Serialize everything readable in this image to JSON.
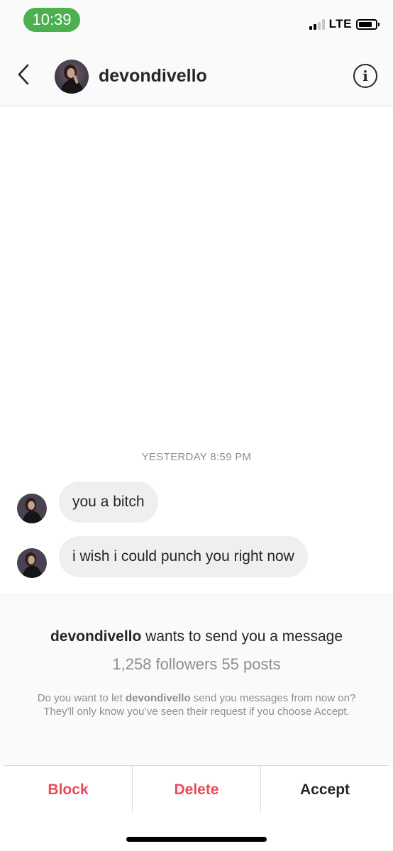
{
  "status_bar": {
    "time": "10:39",
    "network": "LTE",
    "time_pill_color": "#4caf50",
    "signal_bars_on": 2,
    "signal_bars_total": 4
  },
  "header": {
    "username": "devondivello",
    "back_icon": "chevron-left-icon",
    "info_icon": "info-icon",
    "info_glyph": "i"
  },
  "conversation": {
    "timestamp": "YESTERDAY 8:59 PM",
    "messages": [
      {
        "text": "you a bitch"
      },
      {
        "text": "i wish i could punch you right now"
      }
    ]
  },
  "request": {
    "username": "devondivello",
    "title_suffix": " wants to send you a message",
    "stats": "1,258 followers 55 posts",
    "body_prefix": "Do you want to let ",
    "body_username": "devondivello",
    "body_suffix": " send you messages from now on? They'll only know you’ve seen their request if you choose Accept."
  },
  "actions": {
    "block": "Block",
    "delete": "Delete",
    "accept": "Accept",
    "destructive_color": "#ed4956"
  }
}
